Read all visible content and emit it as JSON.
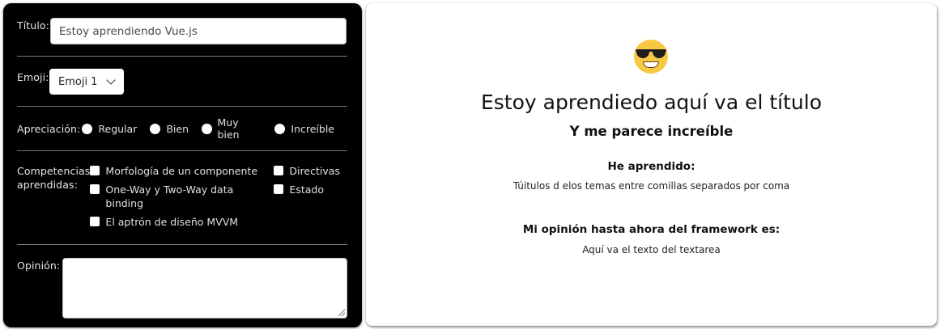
{
  "form": {
    "title_label": "Título:",
    "title_value": "Estoy aprendiendo Vue.js",
    "emoji_label": "Emoji:",
    "emoji_selected": "Emoji 1",
    "appreciation_label": "Apreciación:",
    "appreciation_options": [
      "Regular",
      "Bien",
      "Muy bien",
      "Increíble"
    ],
    "competencies_label": "Competencias aprendidas:",
    "competencies_col1": [
      "Morfología de un componente",
      "One-Way y Two-Way data binding",
      "El aptrón de diseño MVVM"
    ],
    "competencies_col2": [
      "Directivas",
      "Estado"
    ],
    "opinion_label": "Opinión:",
    "opinion_value": ""
  },
  "preview": {
    "emoji_icon": "smiling-face-with-sunglasses",
    "title": "Estoy aprendiedo aquí va el título",
    "subtitle": "Y me parece increíble",
    "learned_heading": "He aprendido:",
    "learned_text": "Túitulos d elos temas entre comillas separados por coma",
    "opinion_heading": "Mi opinión hasta ahora del framework es:",
    "opinion_text": "Aquí va el texto del textarea"
  },
  "colors": {
    "form_bg": "#000000",
    "emoji_yellow": "#f7c844"
  }
}
